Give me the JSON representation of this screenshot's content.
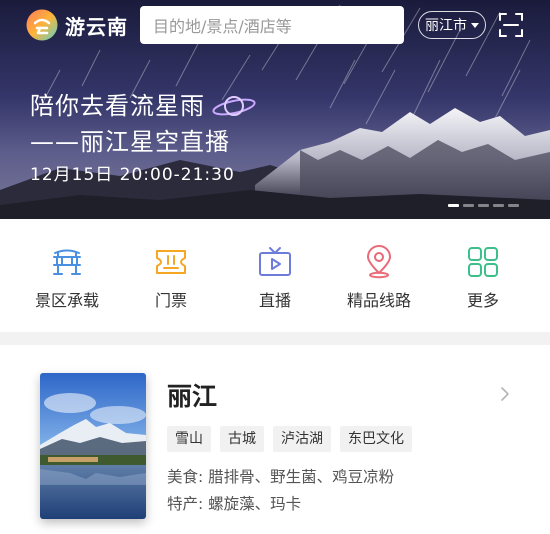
{
  "app": {
    "name": "游云南"
  },
  "search": {
    "placeholder": "目的地/景点/酒店等"
  },
  "city_selector": {
    "label": "丽江市"
  },
  "banner": {
    "line1": "陪你去看流星雨",
    "line2": "——丽江星空直播",
    "line3": "12月15日 20:00-21:30",
    "pages": 5,
    "active_page": 1
  },
  "nav": {
    "items": [
      {
        "label": "景区承载",
        "icon": "scenic-gate-icon",
        "color": "#4a90e2"
      },
      {
        "label": "门票",
        "icon": "ticket-icon",
        "color": "#f5a623"
      },
      {
        "label": "直播",
        "icon": "tv-play-icon",
        "color": "#6c7cd8"
      },
      {
        "label": "精品线路",
        "icon": "location-pin-icon",
        "color": "#e96a78"
      },
      {
        "label": "更多",
        "icon": "grid-more-icon",
        "color": "#3cbf8a"
      }
    ]
  },
  "city_card": {
    "name": "丽江",
    "tags": [
      "雪山",
      "古城",
      "泸沽湖",
      "东巴文化"
    ],
    "food": "美食: 腊排骨、野生菌、鸡豆凉粉",
    "specialty": "特产: 螺旋藻、玛卡"
  }
}
